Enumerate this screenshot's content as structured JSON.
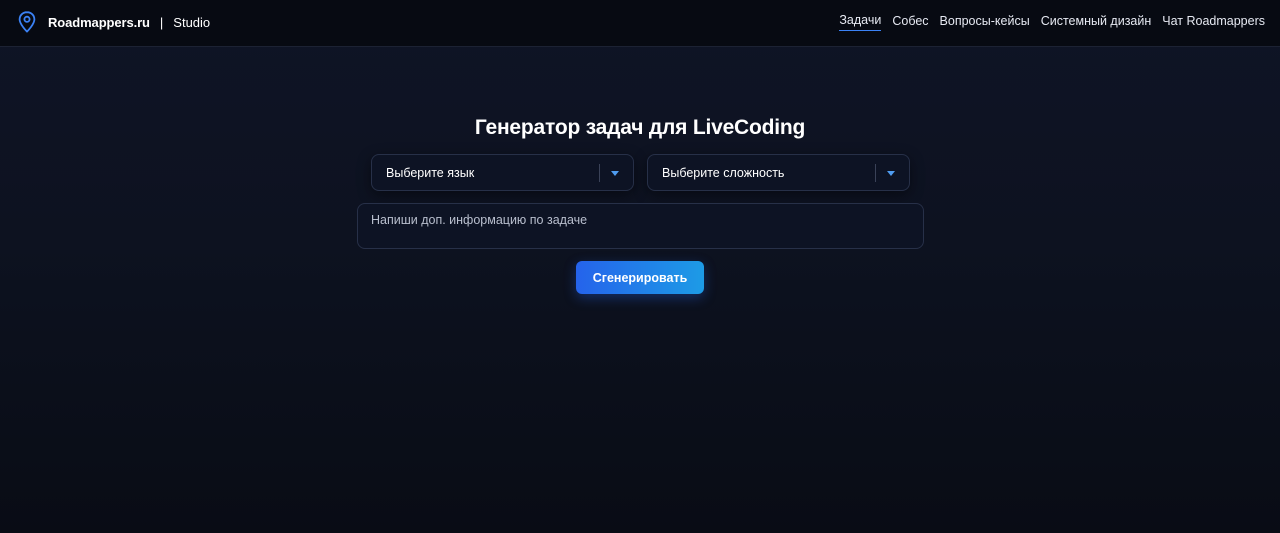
{
  "header": {
    "brand_name": "Roadmappers.ru",
    "separator": "|",
    "brand_sub": "Studio",
    "logo_icon": "location-pin-icon",
    "accent_color": "#3b82f6",
    "nav": [
      {
        "label": "Задачи",
        "active": true
      },
      {
        "label": "Собес",
        "active": false
      },
      {
        "label": "Вопросы-кейсы",
        "active": false
      },
      {
        "label": "Системный дизайн",
        "active": false
      },
      {
        "label": "Чат Roadmappers",
        "active": false
      }
    ]
  },
  "main": {
    "title": "Генератор задач для LiveCoding",
    "language_select": {
      "value": "Выберите язык",
      "icon": "chevron-down-icon"
    },
    "difficulty_select": {
      "value": "Выберите сложность",
      "icon": "chevron-down-icon"
    },
    "info_input": {
      "placeholder": "Напиши доп. информацию по задаче",
      "value": ""
    },
    "generate_button": {
      "label": "Сгенерировать"
    }
  }
}
